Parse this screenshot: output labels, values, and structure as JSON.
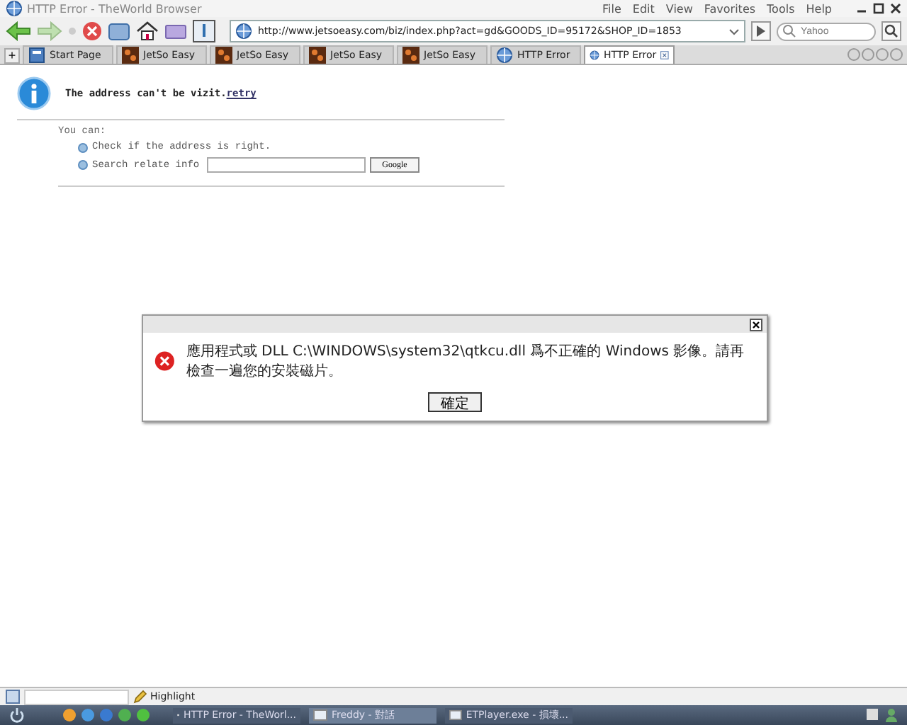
{
  "window": {
    "title": "HTTP Error - TheWorld Browser"
  },
  "menu": [
    "File",
    "Edit",
    "View",
    "Favorites",
    "Tools",
    "Help"
  ],
  "address_bar": {
    "value": "http://www.jetsoeasy.com/biz/index.php?act=gd&GOODS_ID=95172&SHOP_ID=1853"
  },
  "search": {
    "placeholder": "Yahoo"
  },
  "new_tab_button": "+",
  "tabs": [
    {
      "label": "Start Page",
      "kind": "page",
      "selected": false
    },
    {
      "label": "JetSo Easy",
      "kind": "site",
      "selected": false
    },
    {
      "label": "JetSo Easy",
      "kind": "site",
      "selected": false
    },
    {
      "label": "JetSo Easy",
      "kind": "site",
      "selected": false
    },
    {
      "label": "JetSo Easy",
      "kind": "site",
      "selected": false
    },
    {
      "label": "HTTP Error",
      "kind": "web",
      "selected": false
    },
    {
      "label": "HTTP Error",
      "kind": "web",
      "selected": true
    }
  ],
  "error_page": {
    "heading": "The address can't be vizit.",
    "retry_link": "retry",
    "intro": "You can:",
    "options": [
      {
        "kind": "text",
        "label": "Check if the address is right."
      },
      {
        "kind": "search",
        "label": "Search relate info",
        "button": "Google"
      }
    ]
  },
  "dialog": {
    "message": "應用程式或 DLL C:\\WINDOWS\\system32\\qtkcu.dll 爲不正確的 Windows 影像。請再檢查一遍您的安裝磁片。",
    "button": "確定"
  },
  "status_bar": {
    "highlight": "Highlight"
  },
  "taskbar": {
    "items": [
      {
        "label": "HTTP Error - TheWorl...",
        "selected": false
      },
      {
        "label": "Freddy - 對話",
        "selected": true
      },
      {
        "label": "ETPlayer.exe - 損壞...",
        "selected": false
      }
    ]
  }
}
